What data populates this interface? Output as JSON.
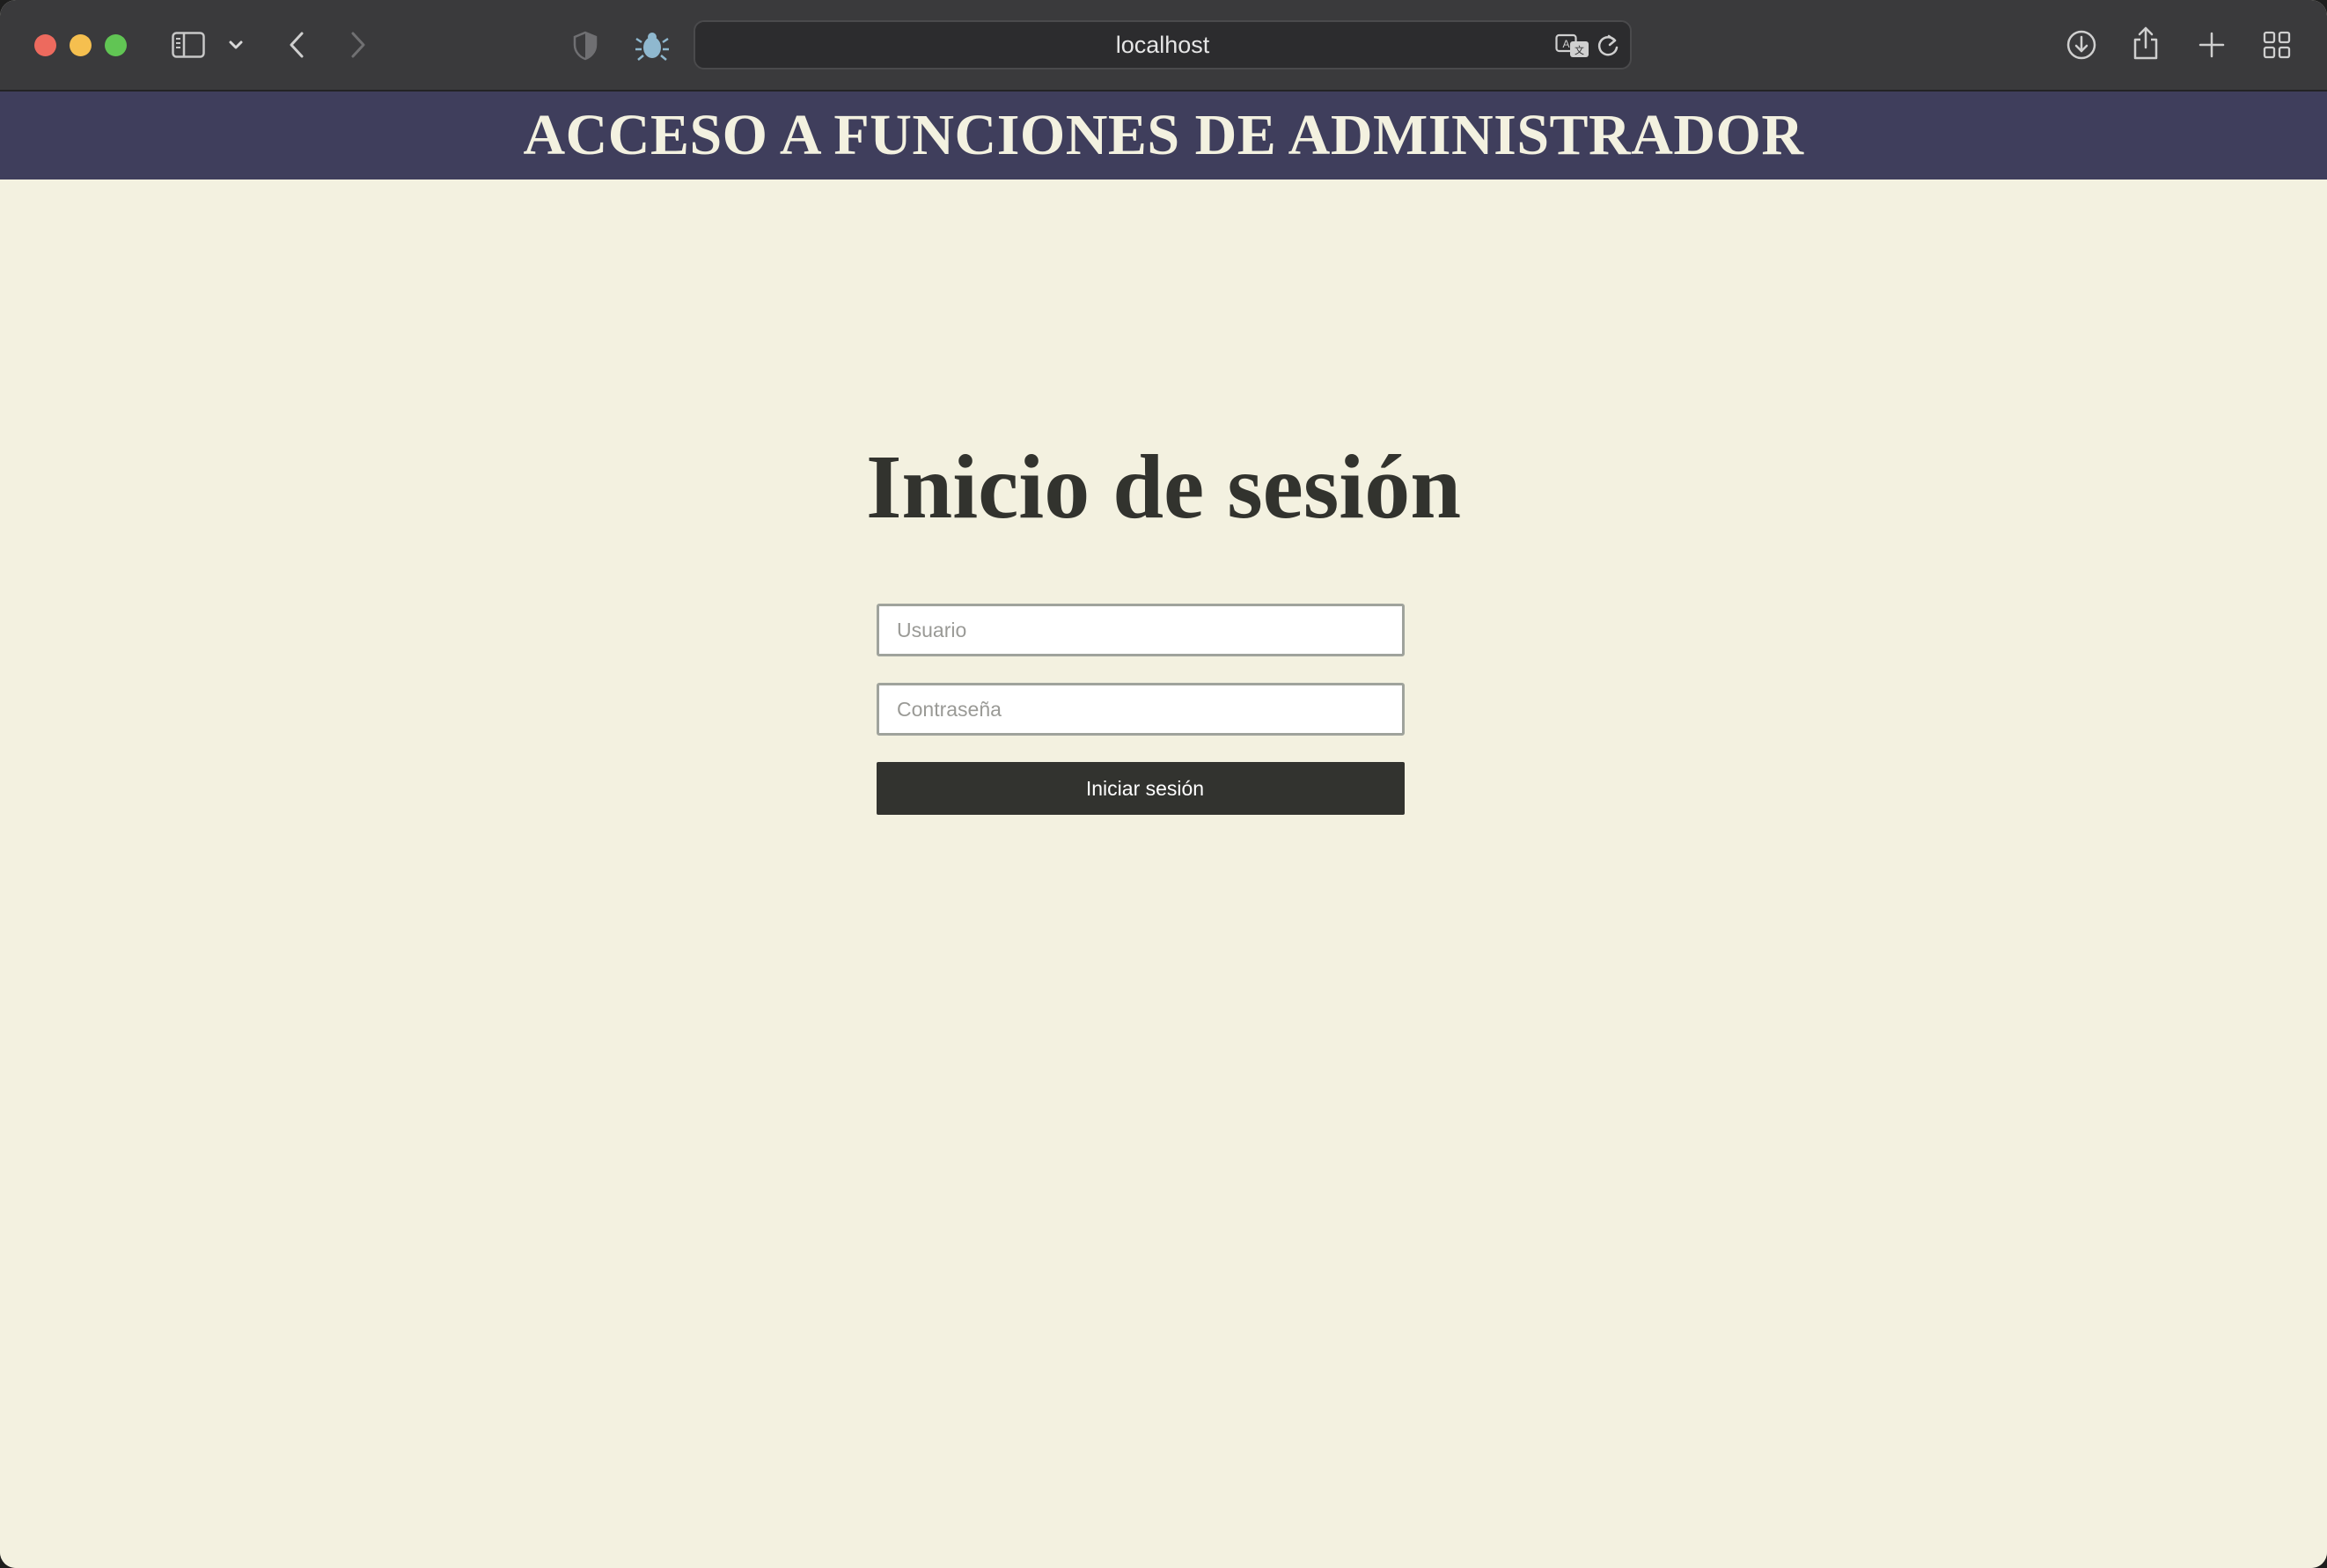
{
  "browser": {
    "url": "localhost",
    "icons": {
      "sidebar": "sidebar-icon",
      "sidebar_menu": "chevron-down-icon",
      "back": "chevron-left-icon",
      "forward": "chevron-right-icon",
      "privacy": "shield-icon",
      "extension": "bug-icon",
      "translate": "translate-icon",
      "reload": "reload-icon",
      "downloads": "download-icon",
      "share": "share-icon",
      "new_tab": "plus-icon",
      "tab_overview": "grid-icon"
    }
  },
  "header": {
    "title": "ACCESO A FUNCIONES DE ADMINISTRADOR"
  },
  "login": {
    "heading": "Inicio de sesión",
    "username_placeholder": "Usuario",
    "username_value": "",
    "password_placeholder": "Contraseña",
    "password_value": "",
    "submit_label": "Iniciar sesión"
  },
  "colors": {
    "banner": "#3f3e5c",
    "page_background": "#f3f1e0",
    "button": "#32332f",
    "heading_text": "#32332e"
  }
}
